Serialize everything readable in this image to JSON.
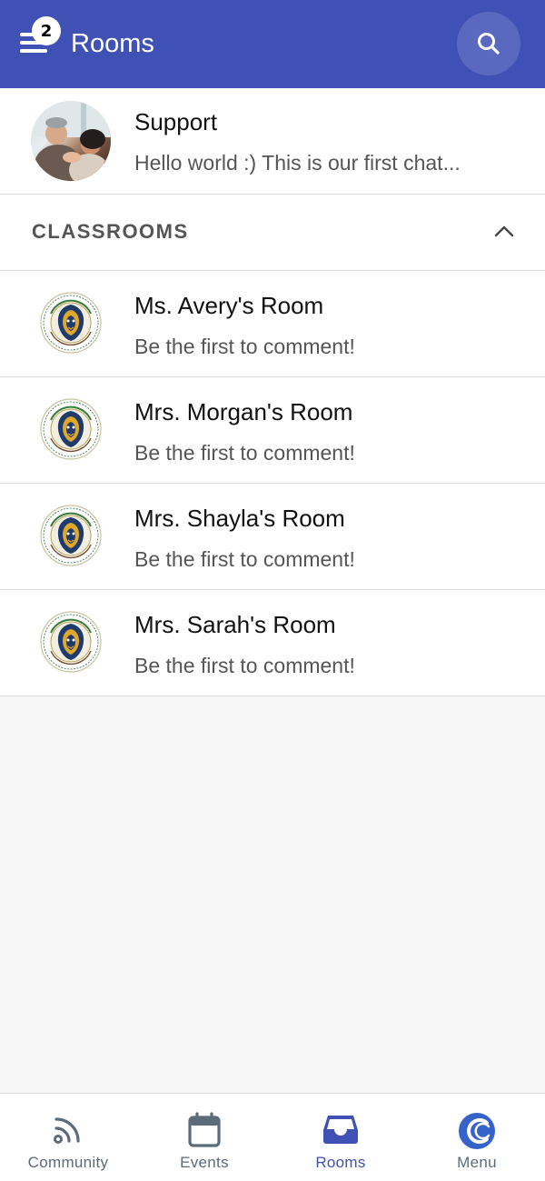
{
  "header": {
    "title": "Rooms",
    "badge_count": "2",
    "menu_icon": "hamburger-icon",
    "search_icon": "search-icon",
    "background_color": "#3f51b5"
  },
  "support": {
    "title": "Support",
    "preview": "Hello world :) This is our first chat..."
  },
  "section": {
    "title": "CLASSROOMS",
    "toggle_icon": "chevron-up-icon"
  },
  "rooms": [
    {
      "title": "Ms. Avery's Room",
      "preview": "Be the first to comment!"
    },
    {
      "title": "Mrs. Morgan's Room",
      "preview": "Be the first to comment!"
    },
    {
      "title": "Mrs. Shayla's Room",
      "preview": "Be the first to comment!"
    },
    {
      "title": "Mrs. Sarah's Room",
      "preview": "Be the first to comment!"
    }
  ],
  "nav": {
    "items": [
      {
        "label": "Community",
        "icon": "rss-icon",
        "active": false
      },
      {
        "label": "Events",
        "icon": "calendar-icon",
        "active": false
      },
      {
        "label": "Rooms",
        "icon": "inbox-icon",
        "active": true
      },
      {
        "label": "Menu",
        "icon": "app-logo-icon",
        "active": false
      }
    ],
    "active_color": "#3f51b5",
    "inactive_color": "#5c6b7a"
  }
}
